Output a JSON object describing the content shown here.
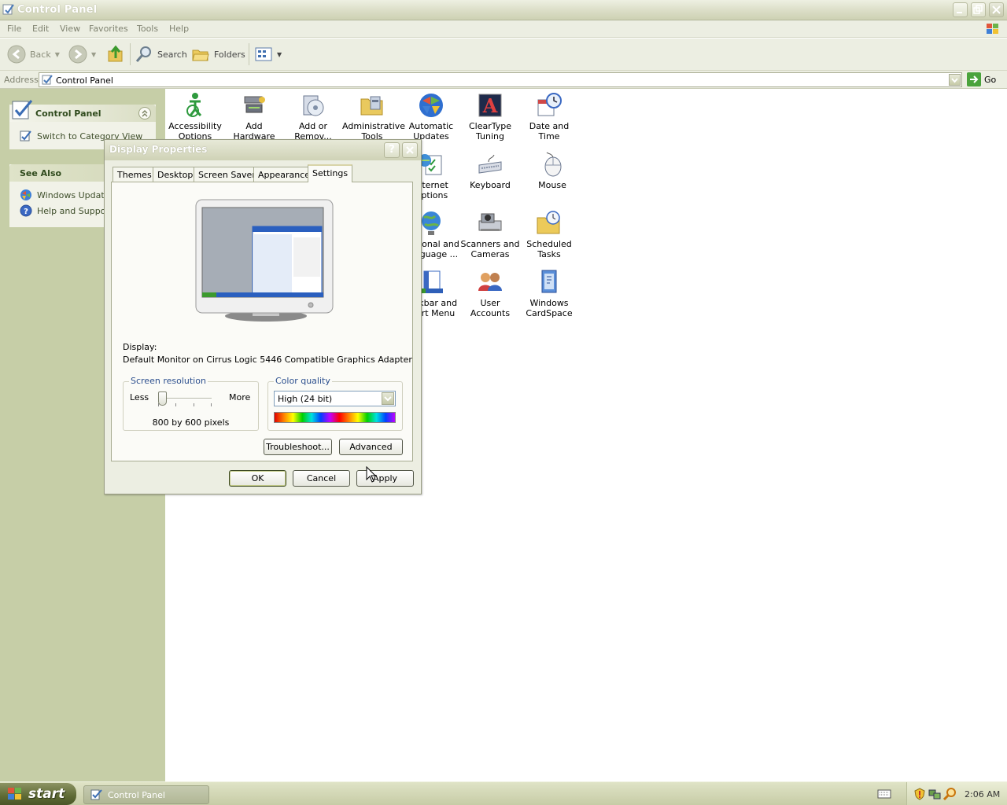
{
  "window": {
    "title": "Control Panel"
  },
  "menu": [
    "File",
    "Edit",
    "View",
    "Favorites",
    "Tools",
    "Help"
  ],
  "toolbar": {
    "back": "Back",
    "search": "Search",
    "folders": "Folders"
  },
  "address": {
    "label": "Address",
    "value": "Control Panel",
    "go": "Go"
  },
  "taskpane": {
    "control_panel": {
      "title": "Control Panel",
      "switch_link": "Switch to Category View"
    },
    "see_also": {
      "title": "See Also",
      "links": [
        "Windows Update",
        "Help and Support"
      ]
    }
  },
  "icons": {
    "accessibility": "Accessibility Options",
    "add_hardware": "Add Hardware",
    "add_remove": "Add or Remov...",
    "admin_tools": "Administrative Tools",
    "auto_updates": "Automatic Updates",
    "cleartype": "ClearType Tuning",
    "date_time": "Date and Time",
    "internet": "Internet Options",
    "keyboard": "Keyboard",
    "mouse": "Mouse",
    "regional": "Regional and Language ...",
    "scanners": "Scanners and Cameras",
    "scheduled": "Scheduled Tasks",
    "taskbar": "Taskbar and Start Menu",
    "users": "User Accounts",
    "cardspace": "Windows CardSpace"
  },
  "dialog": {
    "title": "Display Properties",
    "tabs": [
      "Themes",
      "Desktop",
      "Screen Saver",
      "Appearance",
      "Settings"
    ],
    "display_label": "Display:",
    "display_value": "Default Monitor on Cirrus Logic 5446 Compatible Graphics Adapter",
    "resolution": {
      "label": "Screen resolution",
      "less": "Less",
      "more": "More",
      "value": "800 by 600 pixels"
    },
    "color": {
      "label": "Color quality",
      "value": "High (24 bit)"
    },
    "troubleshoot": "Troubleshoot...",
    "advanced": "Advanced",
    "ok": "OK",
    "cancel": "Cancel",
    "apply": "Apply"
  },
  "taskbar": {
    "start": "start",
    "task": "Control Panel",
    "clock": "2:06 AM"
  }
}
